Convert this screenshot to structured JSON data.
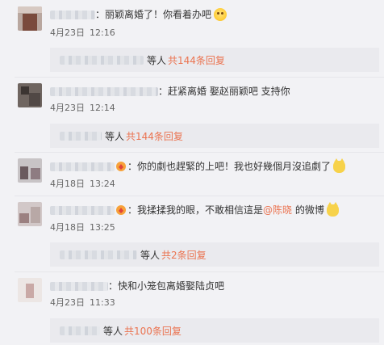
{
  "comments": [
    {
      "text": "丽颖离婚了！你看着办吧",
      "date": "4月23日",
      "time": "12:16",
      "reply_who": "等人",
      "reply_count": "共144条回复"
    },
    {
      "text": "赶紧离婚 娶赵丽颖吧 支持你",
      "date": "4月23日",
      "time": "12:14",
      "reply_who": "等人",
      "reply_count": "共144条回复"
    },
    {
      "text": "你的劇也趕緊的上吧！我也好幾個月沒追劇了",
      "date": "4月18日",
      "time": "13:24"
    },
    {
      "text_before": "我揉揉我的眼，不敢相信這是",
      "mention": "@陈晓",
      "text_after": " 的微博",
      "date": "4月18日",
      "time": "13:25",
      "reply_who": "等人",
      "reply_count": "共2条回复"
    },
    {
      "text": "快和小笼包离婚娶陆贞吧",
      "date": "4月23日",
      "time": "11:33",
      "reply_who": "等人",
      "reply_count": "共100条回复"
    }
  ],
  "colon": "：",
  "icons": {
    "emoji_smile": "smile-emoji-icon",
    "emoji_cat": "cat-emoji-icon",
    "badge": "member-badge-icon"
  },
  "colors": {
    "background": "#f2f2f5",
    "link": "#eb7350",
    "reply_box": "#eaeaee"
  }
}
